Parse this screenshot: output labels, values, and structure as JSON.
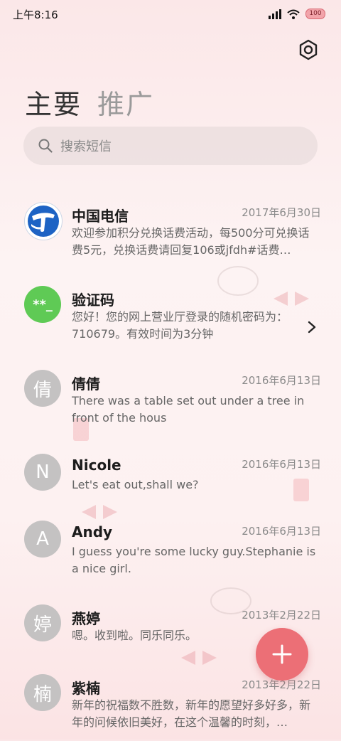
{
  "status_bar": {
    "time": "上午8:16",
    "battery": "100"
  },
  "tabs": {
    "main": "主要",
    "promo": "推广"
  },
  "search": {
    "placeholder": "搜索短信"
  },
  "messages": [
    {
      "name": "中国电信",
      "date": "2017年6月30日",
      "preview": "欢迎参加积分兑换话费活动，每500分可兑换话费5元，兑换话费请回复106或jfdh#话费…",
      "avatar": "telecom-logo"
    },
    {
      "name": "验证码",
      "date": "",
      "preview": "您好！您的网上营业厅登录的随机密码为：710679。有效时间为3分钟",
      "avatar_text": "**_"
    },
    {
      "name": "倩倩",
      "date": "2016年6月13日",
      "preview": "There was a table set out under a tree in front of the hous",
      "avatar_text": "倩"
    },
    {
      "name": "Nicole",
      "date": "2016年6月13日",
      "preview": "Let's eat out,shall we?",
      "avatar_text": "N"
    },
    {
      "name": "Andy",
      "date": "2016年6月13日",
      "preview": "I guess you're some lucky guy.Stephanie is a nice girl.",
      "avatar_text": "A"
    },
    {
      "name": "燕婷",
      "date": "2013年2月22日",
      "preview": "嗯。收到啦。同乐同乐。",
      "avatar_text": "婷"
    },
    {
      "name": "紫楠",
      "date": "2013年2月22日",
      "preview": "新年的祝福数不胜数，新年的愿望好多好多，新年的问候依旧美好，在这个温馨的时刻，…",
      "avatar_text": "楠"
    }
  ],
  "colors": {
    "accent": "#ec6f76",
    "green_avatar": "#5fca55",
    "gray_avatar": "#c4c2c2"
  }
}
